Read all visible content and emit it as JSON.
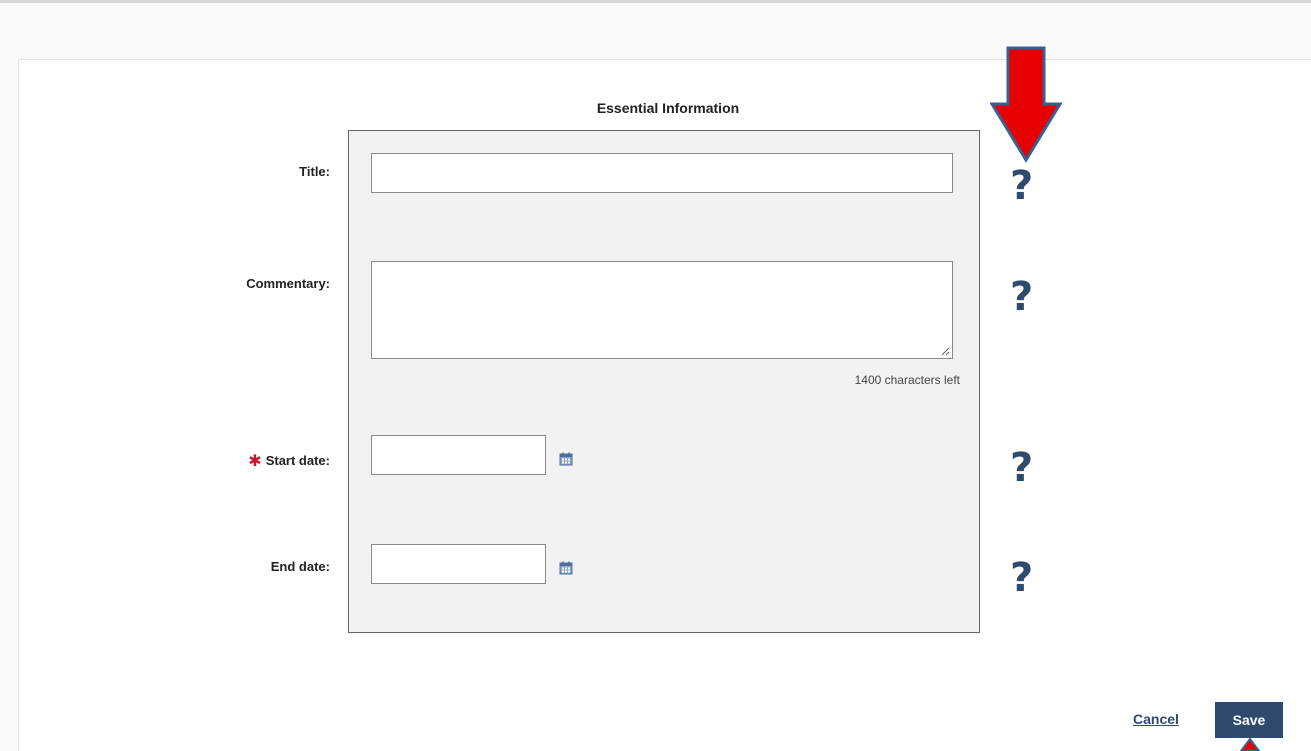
{
  "form": {
    "section_title": "Essential Information",
    "fields": {
      "title": {
        "label": "Title:",
        "value": ""
      },
      "commentary": {
        "label": "Commentary:",
        "value": "",
        "counter": "1400 characters left"
      },
      "start_date": {
        "label": "Start date:",
        "required": true,
        "value": ""
      },
      "end_date": {
        "label": "End date:",
        "value": ""
      }
    },
    "help_glyph": "?"
  },
  "actions": {
    "cancel_label": "Cancel",
    "save_label": "Save"
  },
  "colors": {
    "accent": "#2e4b6e",
    "required": "#c0192b",
    "annotation_arrow": "#e60000",
    "panel_bg": "#f2f2f2"
  },
  "icons": {
    "help": "question-mark-icon",
    "calendar": "calendar-icon",
    "annotation": "red-arrow-down-icon"
  }
}
